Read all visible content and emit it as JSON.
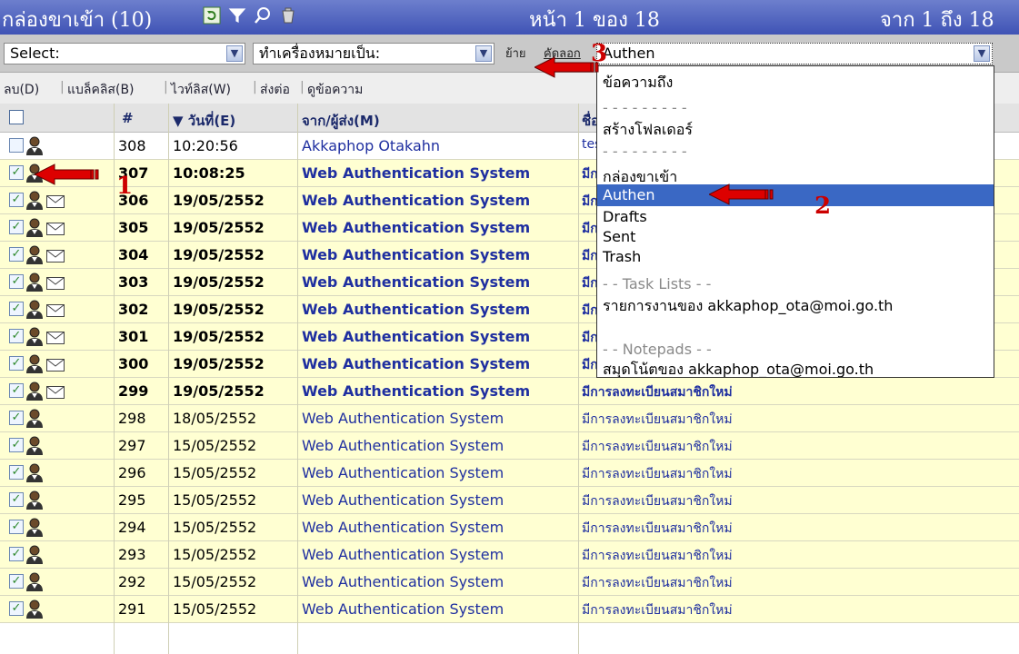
{
  "titlebar": {
    "title": "กล่องขาเข้า (10)",
    "page_info": "หน้า 1 ของ 18",
    "range_info": "จาก 1 ถึง 18"
  },
  "selectbar": {
    "select_value": "Select:",
    "mark_as_value": "ทำเครื่องหมายเป็น:",
    "move_label": "ย้าย",
    "copy_label": "คัดลอก",
    "folder_value": "Authen"
  },
  "actionbar": {
    "delete": "ลบ(D)",
    "blacklist": "แบล็คลิส(B)",
    "whitelist": "ไวท์ลิส(W)",
    "forward": "ส่งต่อ",
    "view": "ดูข้อความ"
  },
  "table": {
    "headers": {
      "num": "#",
      "date": "▼ วันที่(E)",
      "from": "จาก/ผู้ส่ง(M)",
      "subject": "ชื่อเรื่อง"
    },
    "rows": [
      {
        "num": "308",
        "date": "10:20:56",
        "from": "Akkaphop Otakahn",
        "subject": "test"
      },
      {
        "num": "307",
        "date": "10:08:25",
        "from": "Web Authentication System",
        "subject": "มีการลงทะเบียนสมาชิกใหม่"
      },
      {
        "num": "306",
        "date": "19/05/2552",
        "from": "Web Authentication System",
        "subject": "มีการลงทะเบียนสมาชิกใหม่"
      },
      {
        "num": "305",
        "date": "19/05/2552",
        "from": "Web Authentication System",
        "subject": "มีการลงทะเบียนสมาชิกใหม่"
      },
      {
        "num": "304",
        "date": "19/05/2552",
        "from": "Web Authentication System",
        "subject": "มีการลงทะเบียนสมาชิกใหม่"
      },
      {
        "num": "303",
        "date": "19/05/2552",
        "from": "Web Authentication System",
        "subject": "มีการลงทะเบียนสมาชิกใหม่"
      },
      {
        "num": "302",
        "date": "19/05/2552",
        "from": "Web Authentication System",
        "subject": "มีการลงทะเบียนสมาชิกใหม่"
      },
      {
        "num": "301",
        "date": "19/05/2552",
        "from": "Web Authentication System",
        "subject": "มีการลงทะเบียนสมาชิกใหม่"
      },
      {
        "num": "300",
        "date": "19/05/2552",
        "from": "Web Authentication System",
        "subject": "มีการลงทะเบียนสมาชิกใหม่"
      },
      {
        "num": "299",
        "date": "19/05/2552",
        "from": "Web Authentication System",
        "subject": "มีการลงทะเบียนสมาชิกใหม่"
      },
      {
        "num": "298",
        "date": "18/05/2552",
        "from": "Web Authentication System",
        "subject": "มีการลงทะเบียนสมาชิกใหม่"
      },
      {
        "num": "297",
        "date": "15/05/2552",
        "from": "Web Authentication System",
        "subject": "มีการลงทะเบียนสมาชิกใหม่"
      },
      {
        "num": "296",
        "date": "15/05/2552",
        "from": "Web Authentication System",
        "subject": "มีการลงทะเบียนสมาชิกใหม่"
      },
      {
        "num": "295",
        "date": "15/05/2552",
        "from": "Web Authentication System",
        "subject": "มีการลงทะเบียนสมาชิกใหม่"
      },
      {
        "num": "294",
        "date": "15/05/2552",
        "from": "Web Authentication System",
        "subject": "มีการลงทะเบียนสมาชิกใหม่"
      },
      {
        "num": "293",
        "date": "15/05/2552",
        "from": "Web Authentication System",
        "subject": "มีการลงทะเบียนสมาชิกใหม่"
      },
      {
        "num": "292",
        "date": "15/05/2552",
        "from": "Web Authentication System",
        "subject": "มีการลงทะเบียนสมาชิกใหม่"
      },
      {
        "num": "291",
        "date": "15/05/2552",
        "from": "Web Authentication System",
        "subject": "มีการลงทะเบียนสมาชิกใหม่"
      }
    ]
  },
  "dropdown": {
    "items": [
      {
        "label": "ข้อความถึง"
      },
      {
        "label": "- - - - - - - - -"
      },
      {
        "label": "สร้างโฟลเดอร์"
      },
      {
        "label": "- - - - - - - - -"
      },
      {
        "label": "กล่องขาเข้า"
      },
      {
        "label": "Authen"
      },
      {
        "label": "Drafts"
      },
      {
        "label": "Sent"
      },
      {
        "label": "Trash"
      },
      {
        "label": "- - Task Lists - -"
      },
      {
        "label": "รายการงานของ akkaphop_ota@moi.go.th"
      },
      {
        "label": "- - Notepads - -"
      },
      {
        "label": "สมุดโน้ตของ akkaphop_ota@moi.go.th"
      }
    ]
  },
  "annotations": {
    "step1": "1",
    "step2": "2",
    "step3": "3"
  },
  "colors": {
    "titlebar": "#4457b8",
    "selected_item": "#3a68c4",
    "row_highlight": "#ffffd2",
    "link_blue": "#1f2fa0",
    "annotation_red": "#cc0000"
  }
}
